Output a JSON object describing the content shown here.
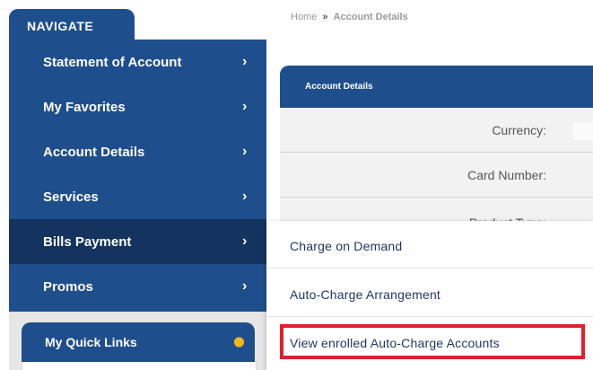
{
  "nav": {
    "title": "NAVIGATE",
    "items": [
      {
        "label": "Statement of Account",
        "active": false
      },
      {
        "label": "My Favorites",
        "active": false
      },
      {
        "label": "Account Details",
        "active": false
      },
      {
        "label": "Services",
        "active": false
      },
      {
        "label": "Bills Payment",
        "active": true
      },
      {
        "label": "Promos",
        "active": false
      }
    ],
    "chevron": "›"
  },
  "quick_links": {
    "label": "My Quick Links",
    "icon": "gear-icon"
  },
  "breadcrumb": {
    "home": "Home",
    "separator": "»",
    "current": "Account Details"
  },
  "card": {
    "header": "Account Details",
    "rows": [
      {
        "label": "Currency:"
      },
      {
        "label": "Card Number:"
      },
      {
        "label": "Product Type:"
      }
    ]
  },
  "submenu": {
    "items": [
      {
        "label": "Charge on Demand"
      },
      {
        "label": "Auto-Charge Arrangement"
      },
      {
        "label": "View enrolled Auto-Charge Accounts",
        "highlighted": true
      }
    ]
  },
  "colors": {
    "primary": "#1f4e8c",
    "active": "#14345f",
    "highlight": "#e0202e",
    "gear": "#f2b71a"
  }
}
